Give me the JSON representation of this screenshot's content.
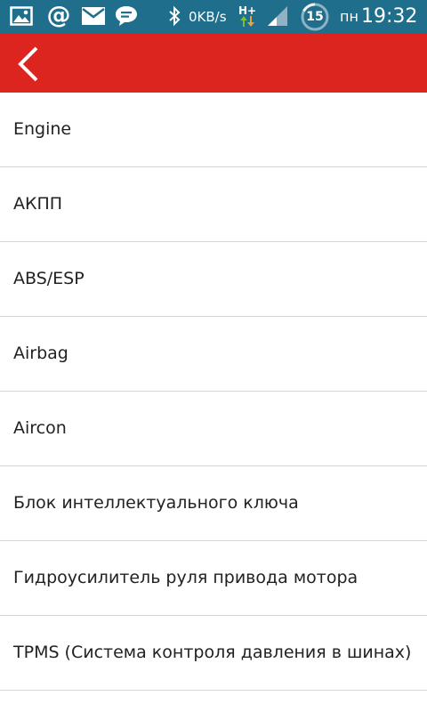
{
  "status_bar": {
    "network_speed": "0KB/s",
    "network_type": "H+",
    "battery_level": "15",
    "day": "пн",
    "time": "19:32"
  },
  "toolbar": {
    "back_icon": "chevron-left-icon"
  },
  "colors": {
    "status_bar": "#1e6e8c",
    "toolbar": "#dd2520",
    "divider": "#d6d6d6",
    "text": "#222222"
  },
  "list": {
    "items": [
      {
        "label": "Engine"
      },
      {
        "label": "АКПП"
      },
      {
        "label": "ABS/ESP"
      },
      {
        "label": "Airbag"
      },
      {
        "label": "Aircon"
      },
      {
        "label": "Блок интеллектуального ключа"
      },
      {
        "label": "Гидроусилитель руля привода мотора"
      },
      {
        "label": "TPMS (Система контроля давления в шинах)"
      }
    ]
  }
}
